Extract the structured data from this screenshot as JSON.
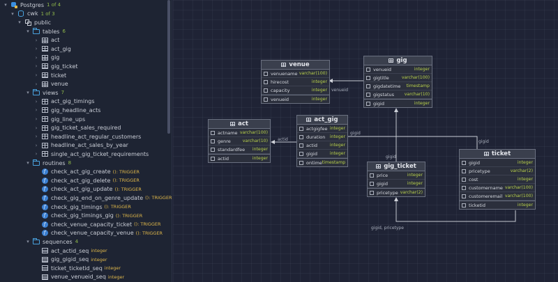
{
  "tree": [
    {
      "id": "pg",
      "level": 0,
      "chev": "▾",
      "icon": "pg",
      "name": "postgres-connection",
      "label": "Postgres",
      "count": "1 of 4"
    },
    {
      "id": "cwk",
      "level": 1,
      "chev": "▾",
      "icon": "db",
      "name": "database-cwk",
      "label": "cwk",
      "count": "1 of 3"
    },
    {
      "id": "public",
      "level": 2,
      "chev": "▾",
      "icon": "schema",
      "name": "schema-public",
      "label": "public"
    },
    {
      "id": "tables",
      "level": 3,
      "chev": "▾",
      "icon": "folder",
      "name": "folder-tables",
      "label": "tables",
      "count": "6"
    },
    {
      "id": "t1",
      "level": 4,
      "chev": "›",
      "icon": "table",
      "name": "table-act",
      "label": "act"
    },
    {
      "id": "t2",
      "level": 4,
      "chev": "›",
      "icon": "table",
      "name": "table-act-gig",
      "label": "act_gig"
    },
    {
      "id": "t3",
      "level": 4,
      "chev": "›",
      "icon": "table",
      "name": "table-gig",
      "label": "gig"
    },
    {
      "id": "t4",
      "level": 4,
      "chev": "›",
      "icon": "table",
      "name": "table-gig-ticket",
      "label": "gig_ticket"
    },
    {
      "id": "t5",
      "level": 4,
      "chev": "›",
      "icon": "table",
      "name": "table-ticket",
      "label": "ticket"
    },
    {
      "id": "t6",
      "level": 4,
      "chev": "›",
      "icon": "table",
      "name": "table-venue",
      "label": "venue"
    },
    {
      "id": "views",
      "level": 3,
      "chev": "▾",
      "icon": "folder",
      "name": "folder-views",
      "label": "views",
      "count": "7"
    },
    {
      "id": "v1",
      "level": 4,
      "chev": "›",
      "icon": "view",
      "name": "view-act-gig-timings",
      "label": "act_gig_timings"
    },
    {
      "id": "v2",
      "level": 4,
      "chev": "›",
      "icon": "view",
      "name": "view-gig-headline-acts",
      "label": "gig_headline_acts"
    },
    {
      "id": "v3",
      "level": 4,
      "chev": "›",
      "icon": "view",
      "name": "view-gig-line-ups",
      "label": "gig_line_ups"
    },
    {
      "id": "v4",
      "level": 4,
      "chev": "›",
      "icon": "view",
      "name": "view-gig-ticket-sales-required",
      "label": "gig_ticket_sales_required"
    },
    {
      "id": "v5",
      "level": 4,
      "chev": "›",
      "icon": "view",
      "name": "view-headline-act-regular-customers",
      "label": "headline_act_regular_customers"
    },
    {
      "id": "v6",
      "level": 4,
      "chev": "›",
      "icon": "view",
      "name": "view-headline-act-sales-by-year",
      "label": "headline_act_sales_by_year"
    },
    {
      "id": "v7",
      "level": 4,
      "chev": "›",
      "icon": "view",
      "name": "view-single-act-gig-ticket-requirements",
      "label": "single_act_gig_ticket_requirements"
    },
    {
      "id": "routines",
      "level": 3,
      "chev": "▾",
      "icon": "folder",
      "name": "folder-routines",
      "label": "routines",
      "count": "8"
    },
    {
      "id": "r1",
      "level": 4,
      "chev": "",
      "icon": "fn",
      "name": "routine-check-act-gig-create",
      "label": "check_act_gig_create",
      "sub": "(): TRIGGER"
    },
    {
      "id": "r2",
      "level": 4,
      "chev": "",
      "icon": "fn",
      "name": "routine-check-act-gig-delete",
      "label": "check_act_gig_delete",
      "sub": "(): TRIGGER"
    },
    {
      "id": "r3",
      "level": 4,
      "chev": "",
      "icon": "fn",
      "name": "routine-check-act-gig-update",
      "label": "check_act_gig_update",
      "sub": "(): TRIGGER"
    },
    {
      "id": "r4",
      "level": 4,
      "chev": "",
      "icon": "fn",
      "name": "routine-check-gig-end-on-genre-update",
      "label": "check_gig_end_on_genre_update",
      "sub": "(): TRIGGER"
    },
    {
      "id": "r5",
      "level": 4,
      "chev": "",
      "icon": "fn",
      "name": "routine-check-gig-timings",
      "label": "check_gig_timings",
      "sub": "(): TRIGGER"
    },
    {
      "id": "r6",
      "level": 4,
      "chev": "",
      "icon": "fn",
      "name": "routine-check-gig-timings-gig",
      "label": "check_gig_timings_gig",
      "sub": "(): TRIGGER"
    },
    {
      "id": "r7",
      "level": 4,
      "chev": "",
      "icon": "fn",
      "name": "routine-check-venue-capacity-ticket",
      "label": "check_venue_capacity_ticket",
      "sub": "(): TRIGGER"
    },
    {
      "id": "r8",
      "level": 4,
      "chev": "",
      "icon": "fn",
      "name": "routine-check-venue-capacity-venue",
      "label": "check_venue_capacity_venue",
      "sub": "(): TRIGGER"
    },
    {
      "id": "seqs",
      "level": 3,
      "chev": "▾",
      "icon": "folder",
      "name": "folder-sequences",
      "label": "sequences",
      "count": "4"
    },
    {
      "id": "s1",
      "level": 4,
      "chev": "",
      "icon": "seq",
      "name": "sequence-act-actid-seq",
      "label": "act_actid_seq",
      "sub": "integer"
    },
    {
      "id": "s2",
      "level": 4,
      "chev": "",
      "icon": "seq",
      "name": "sequence-gig-gigid-seq",
      "label": "gig_gigid_seq",
      "sub": "integer"
    },
    {
      "id": "s3",
      "level": 4,
      "chev": "",
      "icon": "seq",
      "name": "sequence-ticket-ticketid-seq",
      "label": "ticket_ticketid_seq",
      "sub": "integer"
    },
    {
      "id": "s4",
      "level": 4,
      "chev": "",
      "icon": "seq",
      "name": "sequence-venue-venueid-seq",
      "label": "venue_venueid_seq",
      "sub": "integer"
    }
  ],
  "entities": {
    "venue": {
      "title": "venue",
      "cols": [
        {
          "n": "venuename",
          "t": "varchar(100)"
        },
        {
          "n": "hirecost",
          "t": "integer"
        },
        {
          "n": "capacity",
          "t": "integer"
        },
        {
          "n": "venueid",
          "t": "integer"
        }
      ]
    },
    "gig": {
      "title": "gig",
      "cols": [
        {
          "n": "venueid",
          "t": "integer"
        },
        {
          "n": "gigtitle",
          "t": "varchar(100)"
        },
        {
          "n": "gigdatetime",
          "t": "timestamp"
        },
        {
          "n": "gigstatus",
          "t": "varchar(10)"
        },
        {
          "n": "gigid",
          "t": "integer"
        }
      ]
    },
    "act": {
      "title": "act",
      "cols": [
        {
          "n": "actname",
          "t": "varchar(100)"
        },
        {
          "n": "genre",
          "t": "varchar(10)"
        },
        {
          "n": "standardfee",
          "t": "integer"
        },
        {
          "n": "actid",
          "t": "integer"
        }
      ]
    },
    "act_gig": {
      "title": "act_gig",
      "cols": [
        {
          "n": "actgigfee",
          "t": "integer"
        },
        {
          "n": "duration",
          "t": "integer"
        },
        {
          "n": "actid",
          "t": "integer"
        },
        {
          "n": "gigid",
          "t": "integer"
        },
        {
          "n": "ontime",
          "t": "timestamp"
        }
      ]
    },
    "gig_ticket": {
      "title": "gig_ticket",
      "cols": [
        {
          "n": "price",
          "t": "integer"
        },
        {
          "n": "gigid",
          "t": "integer"
        },
        {
          "n": "pricetype",
          "t": "varchar(2)"
        }
      ]
    },
    "ticket": {
      "title": "ticket",
      "cols": [
        {
          "n": "gigid",
          "t": "integer"
        },
        {
          "n": "pricetype",
          "t": "varchar(2)"
        },
        {
          "n": "cost",
          "t": "integer"
        },
        {
          "n": "customername",
          "t": "varchar(100)"
        },
        {
          "n": "customeremail",
          "t": "varchar(100)"
        },
        {
          "n": "ticketid",
          "t": "integer"
        }
      ]
    }
  },
  "link_labels": {
    "venueid": "venueid",
    "actid": "actid",
    "gigid_actgig": "gigid",
    "gigid_ticket": "gigid",
    "gigid_gigticket": "gigid",
    "gigid_pricetype": "gigid, pricetype"
  }
}
